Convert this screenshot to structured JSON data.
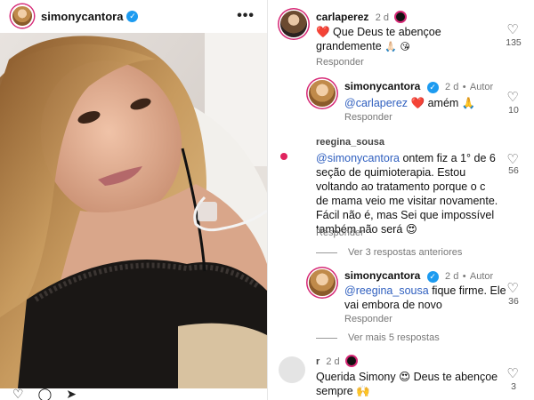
{
  "post": {
    "username": "simonycantora",
    "verified_mark": "✓",
    "more_label": "•••"
  },
  "action_icons": [
    "heart-icon",
    "comment-icon",
    "share-icon"
  ],
  "comments": [
    {
      "username": "carlaperez",
      "time": "2 d",
      "text_line1": "❤️ Que Deus te abençoe",
      "text_line2": "grandemente",
      "reply_label": "Responder",
      "likes": "135"
    },
    {
      "username": "simonycantora",
      "verified_mark": "✓",
      "time": "2 d",
      "author_label": "Autor",
      "mention": "@carlaperez",
      "text": "❤️ amém 🙏",
      "reply_label": "Responder",
      "likes": "10"
    },
    {
      "username": "reegina_sousa",
      "mention": "@simonycantora",
      "text_first": "ontem fiz a 1° de 6",
      "text_lines": [
        "seção de quimioterapia.  Estou",
        "voltando ao tratamento porque o c",
        "de mama veio me visitar novamente.",
        "Fácil não é,  mas Sei que impossível",
        "também não será 😍"
      ],
      "reply_label": "Responder",
      "likes": "56"
    },
    {
      "username": "simonycantora",
      "verified_mark": "✓",
      "time": "2 d",
      "author_label": "Autor",
      "mention": "@reegina_sousa",
      "text_first": "fique firme. Ele",
      "text_line2": "vai embora de novo",
      "reply_label": "Responder",
      "likes": "36"
    },
    {
      "username": "r",
      "time": "2 d",
      "text": "Querida Simony 😍 Deus te abençoe",
      "text_line2": "sempre 🙌",
      "likes": "3"
    }
  ],
  "view_more_previous": "Ver 3 respostas anteriores",
  "view_more_replies": "Ver mais 5 respostas",
  "colors": {
    "verified": "#1d9bf0",
    "mention": "#2f5fbf",
    "story_ring": "#d62976",
    "heart_red": "#e0245e"
  }
}
